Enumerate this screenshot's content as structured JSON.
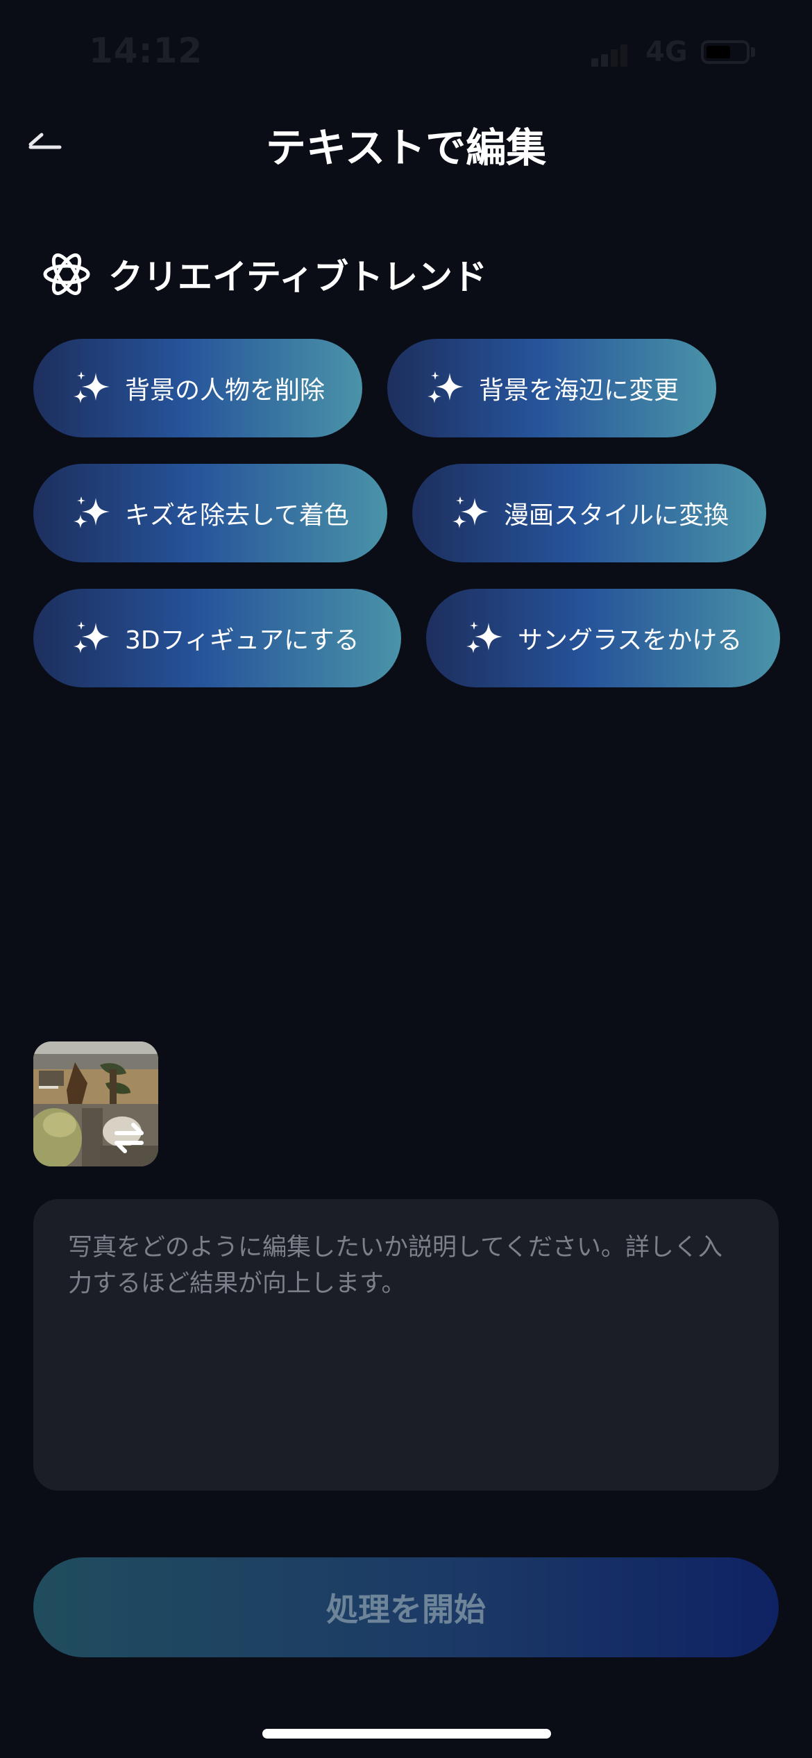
{
  "status_bar": {
    "time": "14:12",
    "network": "4G",
    "icons": [
      "signal-icon",
      "battery-icon"
    ]
  },
  "header": {
    "title": "テキストで編集",
    "back_icon": "back-arrow-icon"
  },
  "section": {
    "title": "クリエイティブトレンド",
    "icon": "atom-icon"
  },
  "chips": [
    {
      "label": "背景の人物を削除",
      "icon": "sparkle-icon"
    },
    {
      "label": "背景を海辺に変更",
      "icon": "sparkle-icon"
    },
    {
      "label": "キズを除去して着色",
      "icon": "sparkle-icon"
    },
    {
      "label": "漫画スタイルに変換",
      "icon": "sparkle-icon"
    },
    {
      "label": "3Dフィギュアにする",
      "icon": "sparkle-icon"
    },
    {
      "label": "サングラスをかける",
      "icon": "sparkle-icon"
    }
  ],
  "photo": {
    "swap_icon": "swap-icon"
  },
  "prompt": {
    "placeholder": "写真をどのように編集したいか説明してください。詳しく入力するほど結果が向上します。",
    "value": ""
  },
  "start_button": {
    "label": "処理を開始"
  },
  "colors": {
    "background": "#0a0d16",
    "chip_gradient_start": "#1d2f5e",
    "chip_gradient_end": "#4a93a8",
    "input_background": "#1b1e26",
    "button_gradient_start": "#204d5e",
    "button_gradient_end": "#0f2263"
  }
}
